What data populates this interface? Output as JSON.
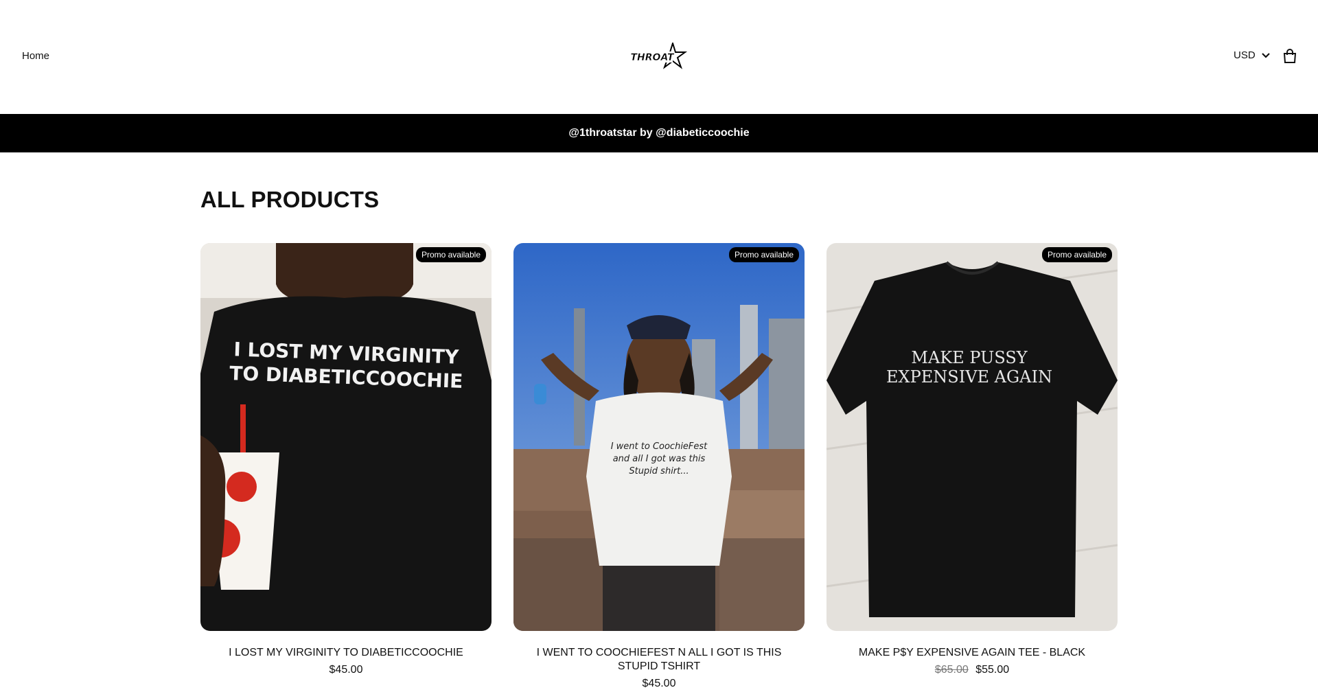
{
  "header": {
    "nav_home": "Home",
    "logo_text": "THROAT",
    "currency": "USD",
    "cart_icon": "bag-icon"
  },
  "announcement": {
    "text": "@1throatstar by @diabeticcoochie"
  },
  "collection": {
    "title": "ALL PRODUCTS",
    "products": [
      {
        "badge": "Promo available",
        "shirt_text_line1": "I LOST MY VIRGINITY",
        "shirt_text_line2": "TO DIABETICCOOCHIE",
        "title": "I LOST MY VIRGINITY TO DIABETICCOOCHIE",
        "price": "$45.00"
      },
      {
        "badge": "Promo available",
        "shirt_text_line1": "I went to CoochieFest",
        "shirt_text_line2": "and all I got was this",
        "shirt_text_line3": "Stupid shirt...",
        "title": "I WENT TO COOCHIEFEST N ALL I GOT IS THIS STUPID TSHIRT",
        "price": "$45.00"
      },
      {
        "badge": "Promo available",
        "shirt_text_line1": "MAKE PUSSY",
        "shirt_text_line2": "EXPENSIVE AGAIN",
        "title": "MAKE P$Y EXPENSIVE AGAIN TEE - BLACK",
        "price_old": "$65.00",
        "price": "$55.00"
      }
    ]
  },
  "colors": {
    "announcement_bg": "#000000",
    "text": "#111111",
    "badge_bg": "#000000"
  }
}
